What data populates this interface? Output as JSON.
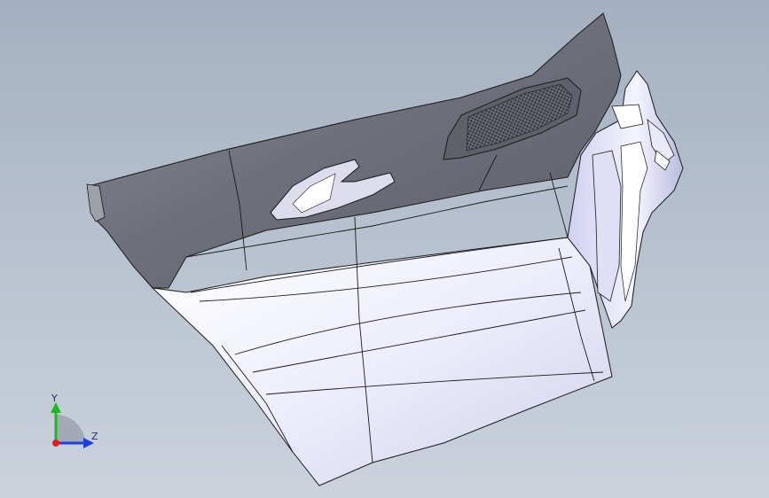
{
  "triad": {
    "y_label": "Y",
    "z_label": "Z",
    "colors": {
      "y": "#1fb81f",
      "z": "#1f3fd6",
      "x": "#e01f1f"
    }
  },
  "model": {
    "top_surface_color": "#6b6d78",
    "body_color": "#e6e6f6",
    "edge_color": "#1a1a1a",
    "grille_color": "#2d2e33"
  }
}
